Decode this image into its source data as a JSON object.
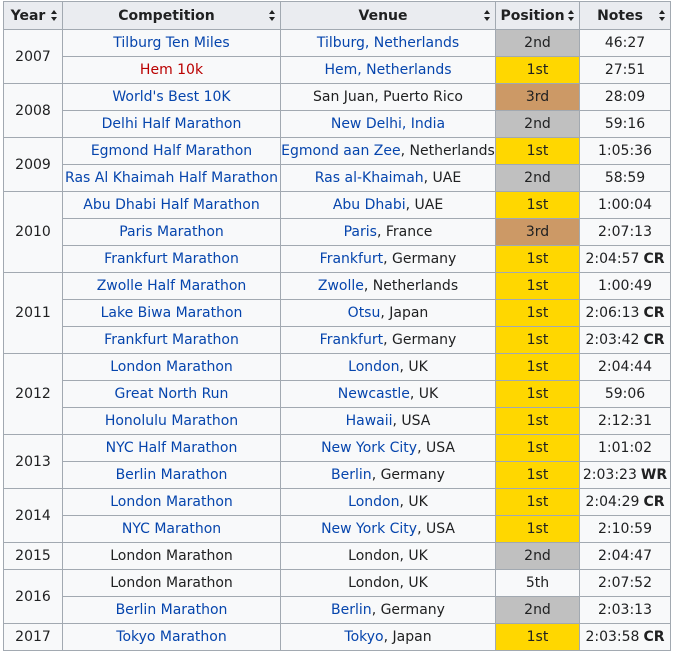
{
  "headers": {
    "year": "Year",
    "competition": "Competition",
    "venue": "Venue",
    "position": "Position",
    "notes": "Notes"
  },
  "colors": {
    "gold": "#ffd700",
    "silver": "#c0c0c0",
    "bronze": "#cc9966",
    "link": "#0645ad",
    "redlink": "#ba0000"
  },
  "rows": [
    {
      "year": "2007",
      "competition": "Tilburg Ten Miles",
      "comp_link": "link",
      "venue_city": "Tilburg, Netherlands",
      "venue_city_linked": true,
      "venue_rest": "",
      "position": "2nd",
      "medal": "silver",
      "notes": "46:27",
      "record": ""
    },
    {
      "year": "",
      "competition": "Hem 10k",
      "comp_link": "new",
      "venue_city": "Hem, Netherlands",
      "venue_city_linked": true,
      "venue_rest": "",
      "position": "1st",
      "medal": "gold",
      "notes": "27:51",
      "record": ""
    },
    {
      "year": "2008",
      "competition": "World's Best 10K",
      "comp_link": "link",
      "venue_city": "",
      "venue_city_linked": false,
      "venue_rest": "San Juan, Puerto Rico",
      "position": "3rd",
      "medal": "bronze",
      "notes": "28:09",
      "record": ""
    },
    {
      "year": "",
      "competition": "Delhi Half Marathon",
      "comp_link": "link",
      "venue_city": "New Delhi, India",
      "venue_city_linked": true,
      "venue_rest": "",
      "position": "2nd",
      "medal": "silver",
      "notes": "59:16",
      "record": ""
    },
    {
      "year": "2009",
      "competition": "Egmond Half Marathon",
      "comp_link": "link",
      "venue_city": "Egmond aan Zee",
      "venue_city_linked": true,
      "venue_rest": ", Netherlands",
      "position": "1st",
      "medal": "gold",
      "notes": "1:05:36",
      "record": ""
    },
    {
      "year": "",
      "competition": "Ras Al Khaimah Half Marathon",
      "comp_link": "link",
      "venue_city": "Ras al-Khaimah",
      "venue_city_linked": true,
      "venue_rest": ", UAE",
      "position": "2nd",
      "medal": "silver",
      "notes": "58:59",
      "record": ""
    },
    {
      "year": "2010",
      "competition": "Abu Dhabi Half Marathon",
      "comp_link": "link",
      "venue_city": "Abu Dhabi",
      "venue_city_linked": true,
      "venue_rest": ", UAE",
      "position": "1st",
      "medal": "gold",
      "notes": "1:00:04",
      "record": ""
    },
    {
      "year": "",
      "competition": "Paris Marathon",
      "comp_link": "link",
      "venue_city": "Paris",
      "venue_city_linked": true,
      "venue_rest": ", France",
      "position": "3rd",
      "medal": "bronze",
      "notes": "2:07:13",
      "record": ""
    },
    {
      "year": "",
      "competition": "Frankfurt Marathon",
      "comp_link": "link",
      "venue_city": "Frankfurt",
      "venue_city_linked": true,
      "venue_rest": ", Germany",
      "position": "1st",
      "medal": "gold",
      "notes": "2:04:57",
      "record": "CR"
    },
    {
      "year": "2011",
      "competition": "Zwolle Half Marathon",
      "comp_link": "link",
      "venue_city": "Zwolle",
      "venue_city_linked": true,
      "venue_rest": ", Netherlands",
      "position": "1st",
      "medal": "gold",
      "notes": "1:00:49",
      "record": ""
    },
    {
      "year": "",
      "competition": "Lake Biwa Marathon",
      "comp_link": "link",
      "venue_city": "Otsu",
      "venue_city_linked": true,
      "venue_rest": ", Japan",
      "position": "1st",
      "medal": "gold",
      "notes": "2:06:13",
      "record": "CR"
    },
    {
      "year": "",
      "competition": "Frankfurt Marathon",
      "comp_link": "link",
      "venue_city": "Frankfurt",
      "venue_city_linked": true,
      "venue_rest": ", Germany",
      "position": "1st",
      "medal": "gold",
      "notes": "2:03:42",
      "record": "CR"
    },
    {
      "year": "2012",
      "competition": "London Marathon",
      "comp_link": "link",
      "venue_city": "London",
      "venue_city_linked": true,
      "venue_rest": ", UK",
      "position": "1st",
      "medal": "gold",
      "notes": "2:04:44",
      "record": ""
    },
    {
      "year": "",
      "competition": "Great North Run",
      "comp_link": "link",
      "venue_city": "Newcastle",
      "venue_city_linked": true,
      "venue_rest": ", UK",
      "position": "1st",
      "medal": "gold",
      "notes": "59:06",
      "record": ""
    },
    {
      "year": "",
      "competition": "Honolulu Marathon",
      "comp_link": "link",
      "venue_city": "Hawaii",
      "venue_city_linked": true,
      "venue_rest": ", USA",
      "position": "1st",
      "medal": "gold",
      "notes": "2:12:31",
      "record": ""
    },
    {
      "year": "2013",
      "competition": "NYC Half Marathon",
      "comp_link": "link",
      "venue_city": "New York City",
      "venue_city_linked": true,
      "venue_rest": ", USA",
      "position": "1st",
      "medal": "gold",
      "notes": "1:01:02",
      "record": ""
    },
    {
      "year": "",
      "competition": "Berlin Marathon",
      "comp_link": "link",
      "venue_city": "Berlin",
      "venue_city_linked": true,
      "venue_rest": ", Germany",
      "position": "1st",
      "medal": "gold",
      "notes": "2:03:23",
      "record": "WR"
    },
    {
      "year": "2014",
      "competition": "London Marathon",
      "comp_link": "link",
      "venue_city": "London",
      "venue_city_linked": true,
      "venue_rest": ", UK",
      "position": "1st",
      "medal": "gold",
      "notes": "2:04:29",
      "record": "CR"
    },
    {
      "year": "",
      "competition": "NYC Marathon",
      "comp_link": "link",
      "venue_city": "New York City",
      "venue_city_linked": true,
      "venue_rest": ", USA",
      "position": "1st",
      "medal": "gold",
      "notes": "2:10:59",
      "record": ""
    },
    {
      "year": "2015",
      "competition": "London Marathon",
      "comp_link": "plain",
      "venue_city": "",
      "venue_city_linked": false,
      "venue_rest": "London, UK",
      "position": "2nd",
      "medal": "silver",
      "notes": "2:04:47",
      "record": ""
    },
    {
      "year": "2016",
      "competition": "London Marathon",
      "comp_link": "plain",
      "venue_city": "",
      "venue_city_linked": false,
      "venue_rest": "London, UK",
      "position": "5th",
      "medal": "plain",
      "notes": "2:07:52",
      "record": ""
    },
    {
      "year": "",
      "competition": "Berlin Marathon",
      "comp_link": "link",
      "venue_city": "Berlin",
      "venue_city_linked": true,
      "venue_rest": ", Germany",
      "position": "2nd",
      "medal": "silver",
      "notes": "2:03:13",
      "record": ""
    },
    {
      "year": "2017",
      "competition": "Tokyo Marathon",
      "comp_link": "link",
      "venue_city": "Tokyo",
      "venue_city_linked": true,
      "venue_rest": ", Japan",
      "position": "1st",
      "medal": "gold",
      "notes": "2:03:58",
      "record": "CR"
    }
  ],
  "year_spans": [
    2,
    0,
    2,
    0,
    2,
    0,
    3,
    0,
    0,
    3,
    0,
    0,
    3,
    0,
    0,
    2,
    0,
    2,
    0,
    1,
    2,
    0,
    1
  ]
}
